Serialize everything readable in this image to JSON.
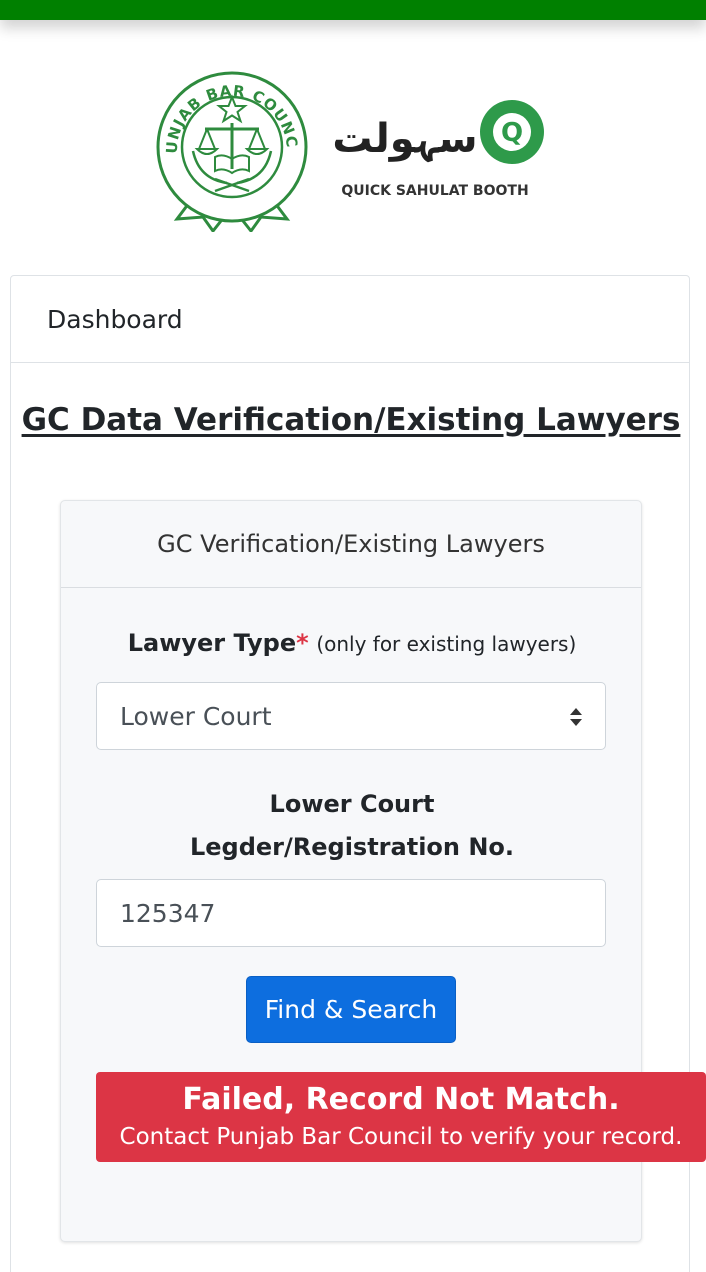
{
  "colors": {
    "top_bar": "#008000",
    "primary_button": "#0d6edf",
    "error_alert": "#dc3545",
    "logo_green": "#2e8b3e"
  },
  "logos": {
    "punjab_bar_council": "PUNJAB BAR COUNCIL",
    "qsb_urdu_word": "سہولت",
    "qsb_badge_letter": "Q",
    "qsb_caption": "QUICK SAHULAT BOOTH"
  },
  "dashboard": {
    "header": "Dashboard",
    "page_title": "GC Data Verification/Existing Lawyers"
  },
  "form": {
    "card_title": "GC Verification/Existing Lawyers",
    "lawyer_type_label": "Lawyer Type",
    "required_mark": "*",
    "lawyer_type_hint": "(only for existing lawyers)",
    "lawyer_type_selected": "Lower Court",
    "registration_label_line1": "Lower Court",
    "registration_label_line2": "Legder/Registration No.",
    "registration_value": "125347",
    "search_button": "Find & Search"
  },
  "alert": {
    "title": "Failed, Record Not Match.",
    "message": "Contact Punjab Bar Council to verify your record."
  }
}
